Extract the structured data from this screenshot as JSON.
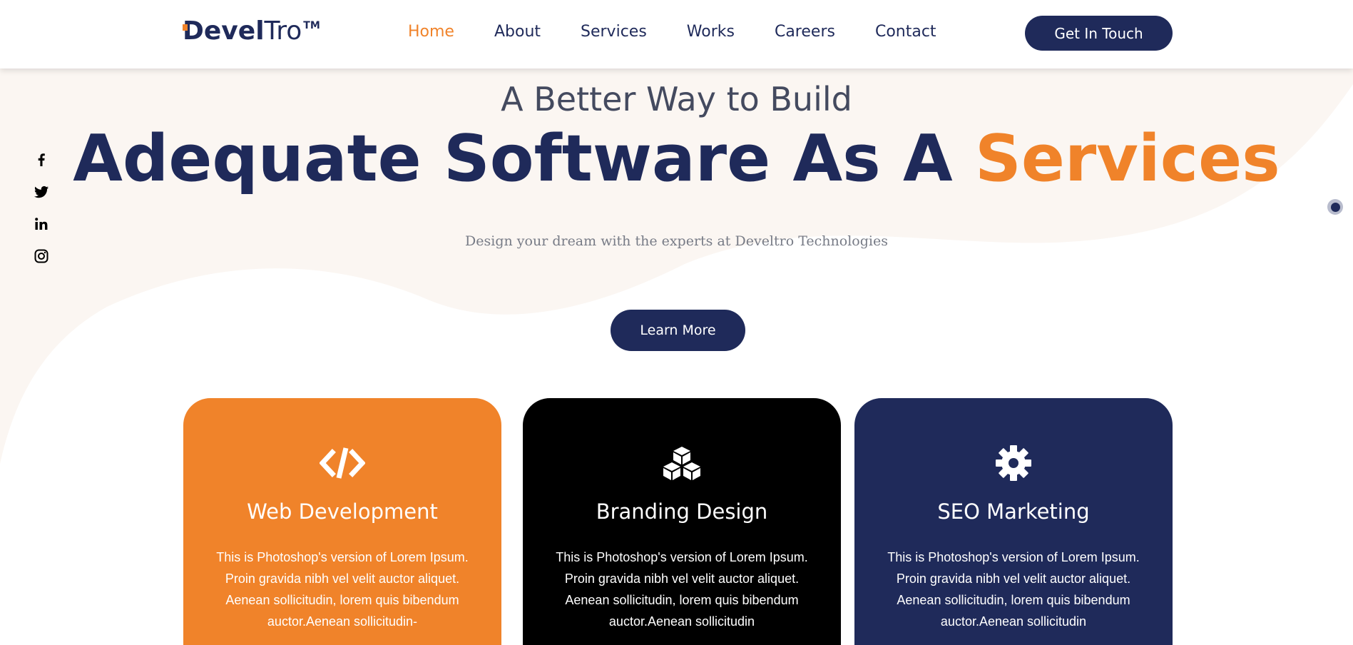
{
  "header": {
    "logo": {
      "d": "D",
      "bold": "evel",
      "light": "Tro",
      "tm": "TM"
    },
    "nav": [
      "Home",
      "About",
      "Services",
      "Works",
      "Careers",
      "Contact"
    ],
    "active_nav": "Home",
    "cta_label": "Get In Touch"
  },
  "social": {
    "icons": [
      "facebook-icon",
      "twitter-icon",
      "linkedin-icon",
      "instagram-icon"
    ]
  },
  "hero": {
    "subtitle": "A Better Way to Build",
    "title_main": "Adequate Software As A ",
    "title_accent": "Services",
    "description": "Design your dream with the experts at Develtro Technologies",
    "button_label": "Learn More"
  },
  "cards": [
    {
      "icon": "code-icon",
      "title": "Web Development",
      "text": "This is Photoshop's version of Lorem Ipsum. Proin gravida nibh vel velit auctor aliquet. Aenean sollicitudin, lorem quis bibendum auctor.Aenean sollicitudin-",
      "color": "#f0832a"
    },
    {
      "icon": "cubes-icon",
      "title": "Branding Design",
      "text": "This is Photoshop's version of Lorem Ipsum. Proin gravida nibh vel velit auctor aliquet. Aenean sollicitudin, lorem quis bibendum auctor.Aenean sollicitudin",
      "color": "#000000"
    },
    {
      "icon": "gear-icon",
      "title": "SEO Marketing",
      "text": "This is Photoshop's version of Lorem Ipsum. Proin gravida nibh vel velit auctor aliquet. Aenean sollicitudin, lorem quis bibendum auctor.Aenean sollicitudin",
      "color": "#1f2a5a"
    }
  ],
  "colors": {
    "navy": "#1f2a5a",
    "orange": "#f0832a",
    "background_blob": "#fbf6f2"
  }
}
